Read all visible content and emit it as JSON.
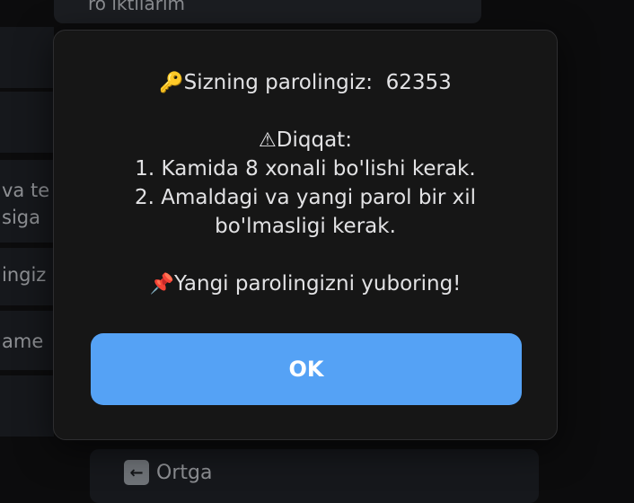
{
  "background": {
    "top_bubble_text": "ro iktilarim",
    "side_cards": [
      {
        "line1": "va te",
        "line2": "siga"
      },
      {
        "line1": "ingiz",
        "line2": ""
      },
      {
        "line1": "ame",
        "line2": ""
      }
    ],
    "back_button": {
      "icon": "arrow-left-icon",
      "label": "Ortga"
    }
  },
  "alert": {
    "password_line": {
      "icon": "key-icon",
      "label": "Sizning parolingiz:",
      "value": "62353"
    },
    "warning": {
      "icon": "warning-icon",
      "title": "Diqqat:",
      "rules": [
        "1. Kamida 8 xonali bo'lishi kerak.",
        "2. Amaldagi va yangi parol bir xil",
        "bo'lmasligi kerak."
      ]
    },
    "instruction": {
      "icon": "pushpin-icon",
      "text": "Yangi parolingizni yuboring!"
    },
    "ok_label": "OK"
  },
  "colors": {
    "accent": "#55a2f5",
    "modal_bg": "#161616",
    "screen_bg": "#0c0c0d"
  }
}
